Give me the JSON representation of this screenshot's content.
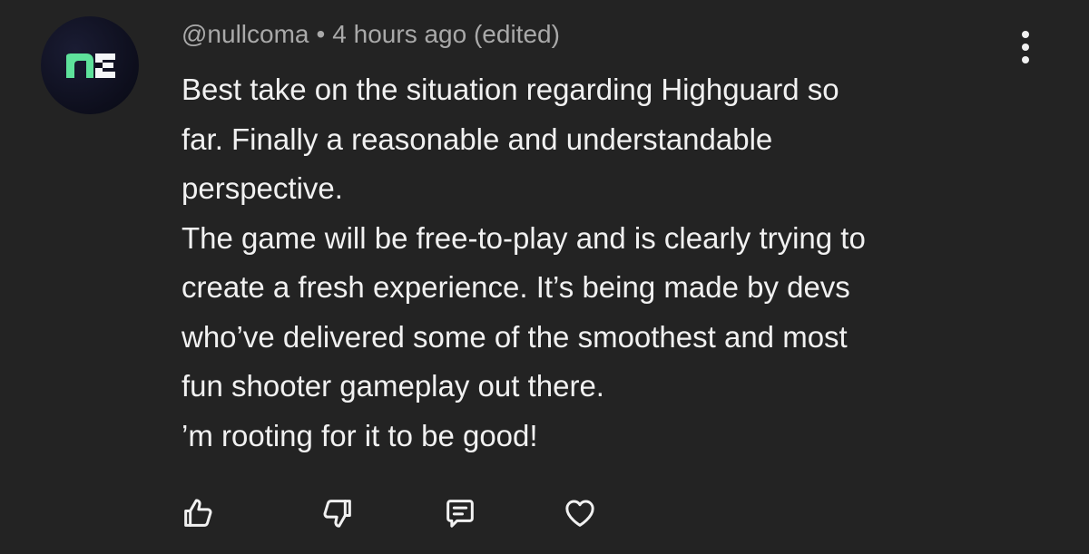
{
  "comment": {
    "author": "@nullcoma",
    "separator": "•",
    "timestamp": "4 hours ago",
    "edited_label": "(edited)",
    "avatar_icon": "nc-logo-icon",
    "text_lines": [
      "Best take on the situation regarding Highguard so",
      "far. Finally a reasonable and understandable",
      "perspective.",
      "The game will be free-to-play and is clearly trying to",
      "create a fresh experience. It’s being made by devs",
      "who’ve delivered some of the smoothest and most",
      "fun shooter gameplay out there.",
      "’m rooting for it to be good!"
    ]
  },
  "menu": {
    "icon": "more-vertical-icon"
  },
  "actions": [
    {
      "icon": "thumbs-up-icon"
    },
    {
      "icon": "thumbs-down-icon"
    },
    {
      "icon": "reply-icon"
    },
    {
      "icon": "heart-icon"
    }
  ],
  "colors": {
    "background": "#232323",
    "text": "#f1f1f1",
    "meta": "#a9a9a9",
    "avatar_green": "#5ee29b",
    "avatar_white": "#f4f6f8"
  }
}
